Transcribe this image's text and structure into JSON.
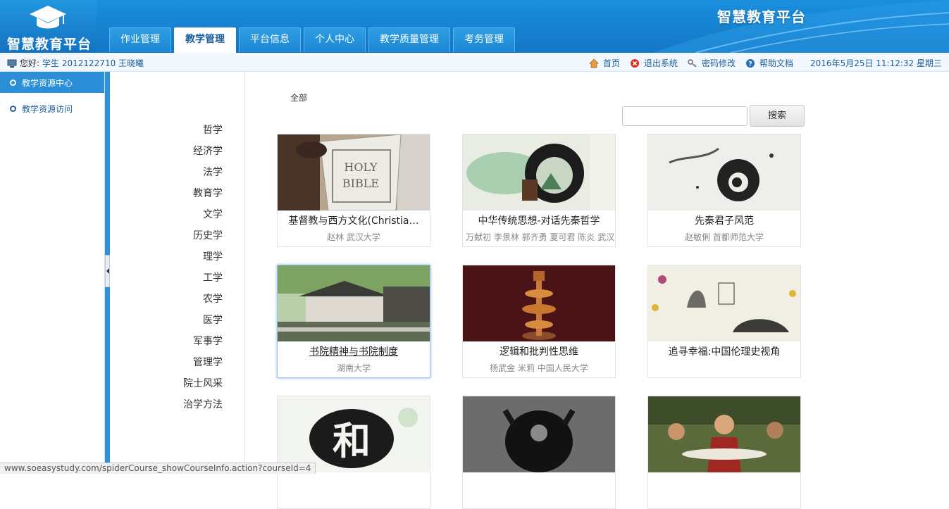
{
  "header": {
    "logo_text": "智慧教育平台",
    "brand_title": "智慧教育平台",
    "tabs": [
      "作业管理",
      "教学管理",
      "平台信息",
      "个人中心",
      "教学质量管理",
      "考务管理"
    ]
  },
  "infobar": {
    "greeting": "您好:",
    "user": "学生  2012122710  王晓曦",
    "links": {
      "home": "首页",
      "logout": "退出系统",
      "password": "密码修改",
      "help": "帮助文档"
    },
    "datetime": "2016年5月25日 11:12:32 星期三"
  },
  "sidebar": {
    "items": [
      "教学资源中心",
      "教学资源访问"
    ]
  },
  "categories": [
    "哲学",
    "经济学",
    "法学",
    "教育学",
    "文学",
    "历史学",
    "理学",
    "工学",
    "农学",
    "医学",
    "军事学",
    "管理学",
    "院士风采",
    "治学方法"
  ],
  "main": {
    "all_label": "全部",
    "search_placeholder": "",
    "search_button": "搜索"
  },
  "cards": [
    {
      "title": "基督教与西方文化(Christia…",
      "sub": "赵林 武汉大学",
      "thumb": "bible"
    },
    {
      "title": "中华传统思想-对话先秦哲学",
      "sub": "万献初 李景林 郭齐勇 夏可君 陈炎 武汉",
      "thumb": "ink-landscape"
    },
    {
      "title": "先秦君子风范",
      "sub": "赵敏俐 首都师范大学",
      "thumb": "ink-taiji"
    },
    {
      "title": "书院精神与书院制度",
      "sub": "湖南大学",
      "thumb": "academy"
    },
    {
      "title": "逻辑和批判性思维",
      "sub": "杨武金 米莉 中国人民大学",
      "thumb": "logic"
    },
    {
      "title": "追寻幸福:中国伦理史视角",
      "sub": "",
      "thumb": "happiness"
    },
    {
      "title": "",
      "sub": "",
      "thumb": "he"
    },
    {
      "title": "",
      "sub": "",
      "thumb": "dark"
    },
    {
      "title": "",
      "sub": "",
      "thumb": "supper"
    }
  ],
  "statusbar": "www.soeasystudy.com/spiderCourse_showCourseInfo.action?courseId=4",
  "colors": {
    "header_blue": "#1476c6",
    "link_blue": "#1d5f9c",
    "sidebar_active": "#2b8fd8"
  }
}
